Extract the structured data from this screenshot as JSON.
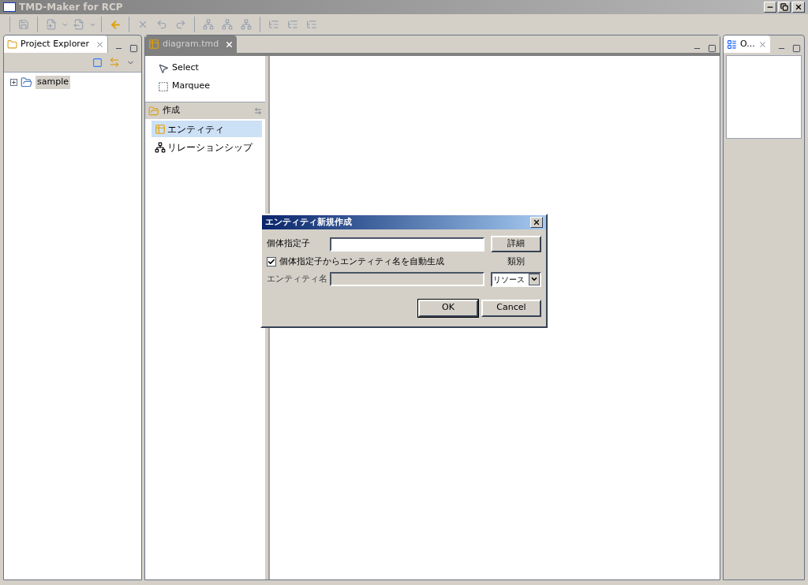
{
  "window": {
    "title": "TMD-Maker for RCP"
  },
  "project_explorer": {
    "tab": "Project Explorer",
    "tree": [
      {
        "label": "sample",
        "expanded": false,
        "selected": true
      }
    ]
  },
  "editor": {
    "tab": "diagram.tmd",
    "palette": {
      "tools": [
        {
          "kind": "select",
          "label": "Select"
        },
        {
          "kind": "marquee",
          "label": "Marquee"
        }
      ],
      "drawer": {
        "label": "作成",
        "expanded": true,
        "items": [
          {
            "kind": "entity",
            "label": "エンティティ",
            "selected": true
          },
          {
            "kind": "relation",
            "label": "リレーションシップ",
            "selected": false
          }
        ]
      }
    }
  },
  "outline": {
    "tab": "O..."
  },
  "dialog": {
    "title": "エンティティ新規作成",
    "identifier_label": "個体指定子",
    "details_button": "詳細",
    "auto_generate": {
      "label": "個体指定子からエンティティ名を自動生成",
      "checked": true
    },
    "category_label": "類別",
    "entity_name_label": "エンティティ名",
    "entity_name_disabled": true,
    "category_value": "リソース",
    "buttons": [
      {
        "label": "OK",
        "default": true
      },
      {
        "label": "Cancel",
        "default": false
      }
    ]
  }
}
